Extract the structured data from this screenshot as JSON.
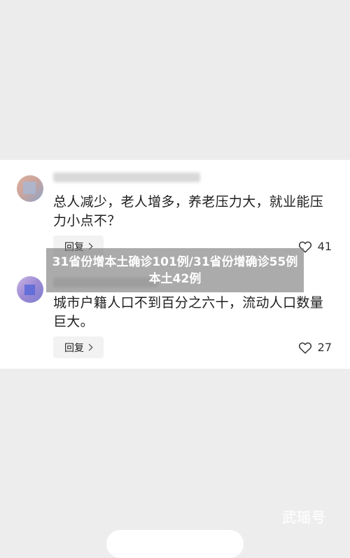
{
  "comments": [
    {
      "text": "总人减少，老人增多，养老压力大，就业能压力小点不？",
      "reply_label": "回复",
      "likes": "41"
    },
    {
      "text": "城市户籍人口不到百分之六十，流动人口数量巨大。",
      "reply_label": "回复",
      "likes": "27"
    }
  ],
  "overlay_headline": "31省份增本土确诊101例/31省份增确诊55例本土42例",
  "watermark": "武瑶号",
  "icons": {
    "reply": "chevron-right-icon",
    "like": "heart-outline-icon"
  }
}
